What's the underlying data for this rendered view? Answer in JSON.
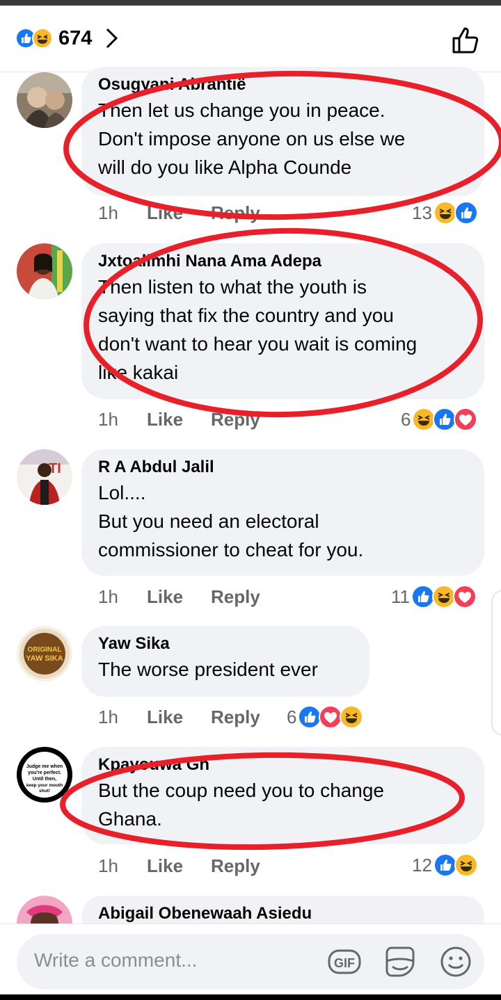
{
  "header": {
    "reaction_count": "674",
    "reactions": [
      "like",
      "haha"
    ]
  },
  "colors": {
    "like_blue": "#1877f2",
    "haha_yellow": "#f7b928",
    "love_red": "#f33e58",
    "bubble_bg": "#f0f2f5",
    "meta_gray": "#65676b",
    "annotation_red": "#e8202a"
  },
  "comments": [
    {
      "author": "Osugyani Abrantië",
      "text": "Then let us change you in peace.\nDon't impose anyone on us else we\nwill do you like Alpha Counde",
      "time": "1h",
      "like": "Like",
      "reply": "Reply",
      "reaction_count": "13",
      "reactions": [
        "haha",
        "like"
      ]
    },
    {
      "author": "Jxtoallmhi Nana Ama Adepa",
      "text": "Then listen to what the youth is\nsaying that fix the country and you\ndon't want to hear you wait is coming\nlike kakai",
      "time": "1h",
      "like": "Like",
      "reply": "Reply",
      "reaction_count": "6",
      "reactions": [
        "haha",
        "like",
        "love"
      ]
    },
    {
      "author": "R A Abdul Jalil",
      "text": "Lol....\nBut you need an electoral\ncommissioner to cheat for you.",
      "time": "1h",
      "like": "Like",
      "reply": "Reply",
      "reaction_count": "11",
      "reactions": [
        "like",
        "haha",
        "love"
      ]
    },
    {
      "author": "Yaw Sika",
      "text": "The worse president ever",
      "time": "1h",
      "like": "Like",
      "reply": "Reply",
      "reaction_count": "6",
      "reactions": [
        "like",
        "love",
        "haha"
      ],
      "avatar_text": "ORIGINAL YAW SIKA"
    },
    {
      "author": "Kpayouwa Gh",
      "text": "But the coup need you to change\nGhana.",
      "time": "1h",
      "like": "Like",
      "reply": "Reply",
      "reaction_count": "12",
      "reactions": [
        "like",
        "haha"
      ],
      "avatar_text": "Judge me when you're perfect. Until then, keep your mouth shut!"
    },
    {
      "author": "Abigail Obenewaah Asiedu"
    }
  ],
  "composer": {
    "placeholder": "Write a comment...",
    "icons": [
      "gif-icon",
      "sticker-icon",
      "emoji-icon"
    ]
  }
}
